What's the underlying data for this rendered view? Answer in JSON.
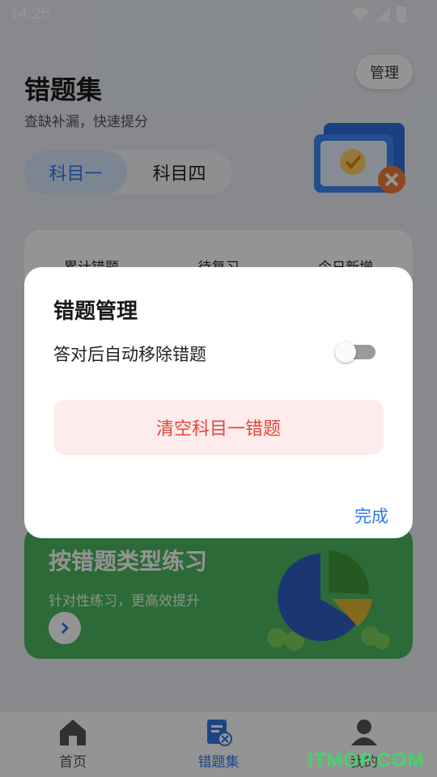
{
  "status_bar": {
    "time": "14:25"
  },
  "header": {
    "title": "错题集",
    "subtitle": "查缺补漏，快速提分",
    "manage_label": "管理"
  },
  "subject_tabs": [
    {
      "label": "科目一",
      "selected": true
    },
    {
      "label": "科目四",
      "selected": false
    }
  ],
  "stats": {
    "labels": [
      "累计错题",
      "待复习",
      "今日新增"
    ]
  },
  "practice_card": {
    "title": "按错题类型练习",
    "subtitle": "针对性练习，更高效提升"
  },
  "bottom_nav": [
    {
      "label": "首页",
      "icon": "home-icon",
      "active": false
    },
    {
      "label": "错题集",
      "icon": "wrong-questions-icon",
      "active": true
    },
    {
      "label": "我的",
      "icon": "person-icon",
      "active": false
    }
  ],
  "dialog": {
    "title": "错题管理",
    "auto_remove_label": "答对后自动移除错题",
    "auto_remove_enabled": false,
    "clear_button": "清空科目一错题",
    "done_button": "完成"
  },
  "watermark": "ITMOP.COM",
  "colors": {
    "accent_blue": "#2f78e6",
    "danger_red": "#e6453a",
    "practice_green": "#4cb760"
  }
}
